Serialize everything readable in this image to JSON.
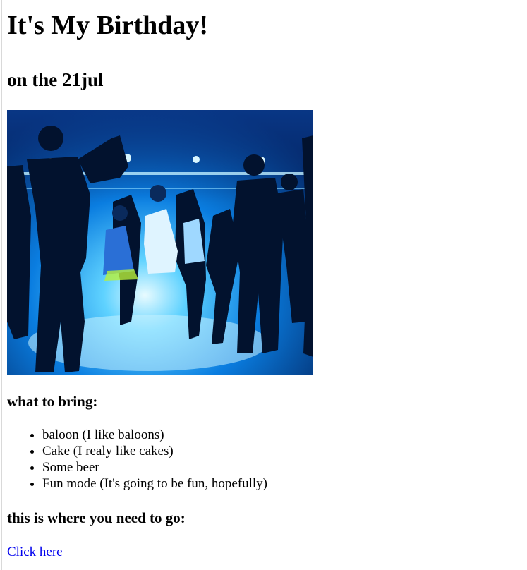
{
  "header": {
    "title": "It's My Birthday!",
    "subtitle": "on the 21jul"
  },
  "photo": {
    "description": "party-crowd-photo"
  },
  "bring_section": {
    "heading": "what to bring:",
    "items": [
      "baloon (I like baloons)",
      "Cake (I realy like cakes)",
      "Some beer",
      "Fun mode (It's going to be fun, hopefully)"
    ]
  },
  "directions_section": {
    "heading": "this is where you need to go:",
    "link_text": "Click here"
  },
  "colors": {
    "link": "#0000ee",
    "text": "#000000",
    "background": "#ffffff"
  }
}
